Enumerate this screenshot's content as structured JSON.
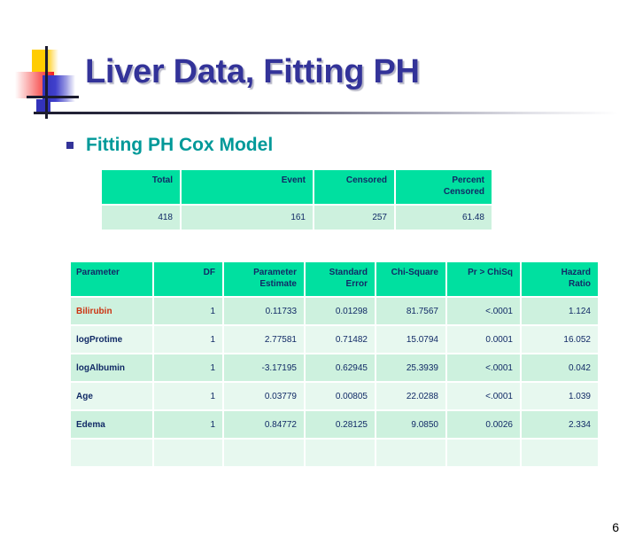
{
  "slide": {
    "title": "Liver Data, Fitting PH",
    "page_number": "6",
    "title_color": "#333399",
    "heading_color": "#009999",
    "table_header_color": "#00e0a0",
    "table_body_color": "#cdf1de",
    "table_alt_body_color": "#e7f8ef",
    "highlight_color": "#cc3311"
  },
  "section": {
    "bullet_label": "Fitting PH Cox Model"
  },
  "summary_table": {
    "headers": [
      "Total",
      "Event",
      "Censored",
      "Percent Censored"
    ],
    "header_lines": [
      [
        "Total"
      ],
      [
        "Event"
      ],
      [
        "Censored"
      ],
      [
        "Percent",
        "Censored"
      ]
    ],
    "rows": [
      [
        "418",
        "161",
        "257",
        "61.48"
      ]
    ]
  },
  "parameter_table": {
    "headers": [
      "Parameter",
      "DF",
      "Parameter Estimate",
      "Standard Error",
      "Chi-Square",
      "Pr > ChiSq",
      "Hazard Ratio"
    ],
    "header_lines": [
      [
        "Parameter"
      ],
      [
        "DF"
      ],
      [
        "Parameter",
        "Estimate"
      ],
      [
        "Standard",
        "Error"
      ],
      [
        "Chi-Square"
      ],
      [
        "Pr > ChiSq"
      ],
      [
        "Hazard",
        "Ratio"
      ]
    ],
    "rows": [
      {
        "parameter": "Bilirubin",
        "highlight": true,
        "df": "1",
        "estimate": "0.11733",
        "std_error": "0.01298",
        "chi_square": "81.7567",
        "p_value": "<.0001",
        "hazard_ratio": "1.124"
      },
      {
        "parameter": "logProtime",
        "highlight": false,
        "df": "1",
        "estimate": "2.77581",
        "std_error": "0.71482",
        "chi_square": "15.0794",
        "p_value": "0.0001",
        "hazard_ratio": "16.052"
      },
      {
        "parameter": "logAlbumin",
        "highlight": false,
        "df": "1",
        "estimate": "-3.17195",
        "std_error": "0.62945",
        "chi_square": "25.3939",
        "p_value": "<.0001",
        "hazard_ratio": "0.042"
      },
      {
        "parameter": "Age",
        "highlight": false,
        "df": "1",
        "estimate": "0.03779",
        "std_error": "0.00805",
        "chi_square": "22.0288",
        "p_value": "<.0001",
        "hazard_ratio": "1.039"
      },
      {
        "parameter": "Edema",
        "highlight": false,
        "df": "1",
        "estimate": "0.84772",
        "std_error": "0.28125",
        "chi_square": "9.0850",
        "p_value": "0.0026",
        "hazard_ratio": "2.334"
      }
    ]
  }
}
